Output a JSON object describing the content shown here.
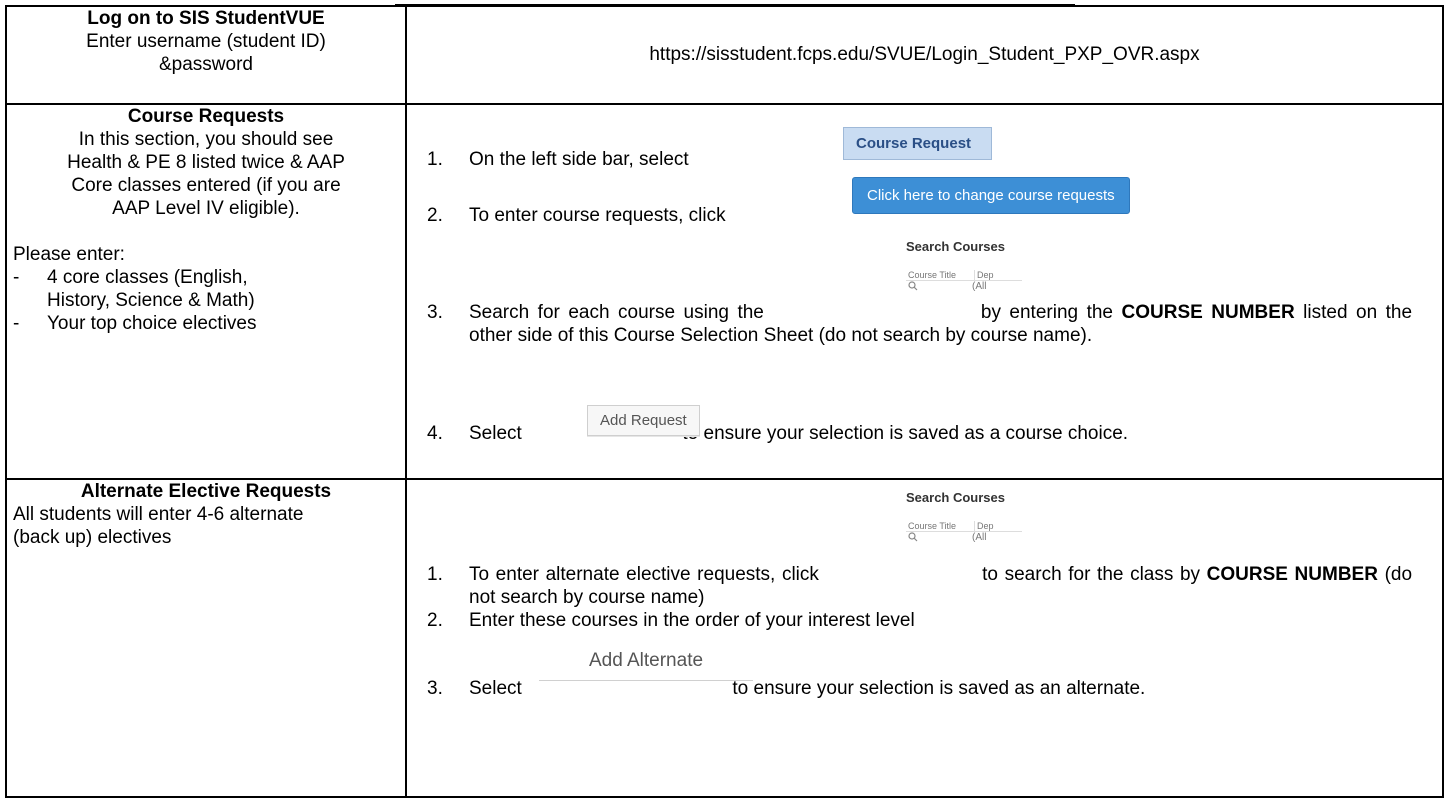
{
  "section_1": {
    "title": "Log on to SIS StudentVUE",
    "desc_line1": "Enter username (student ID)",
    "desc_line2": "&password",
    "url": "https://sisstudent.fcps.edu/SVUE/Login_Student_PXP_OVR.aspx"
  },
  "section_2": {
    "title": "Course Requests",
    "desc": [
      "In this section, you should see",
      "Health & PE 8 listed twice & AAP",
      "Core classes entered (if you are",
      "AAP Level IV eligible)."
    ],
    "please_enter": "Please enter:",
    "bullets": [
      {
        "dash": "-",
        "line1": "4 core classes (English,",
        "line2": "History, Science & Math)"
      },
      {
        "dash": "-",
        "line1": "Your top choice electives",
        "line2": ""
      }
    ],
    "steps": [
      {
        "num": "1.",
        "text": "On the left side bar, select"
      },
      {
        "num": "2.",
        "text": "To enter course requests, click"
      },
      {
        "num": "3.",
        "text_before": "Search for each course using the",
        "text_mid": "by entering the",
        "bold": "COURSE NUMBER",
        "text_after": "listed on the other side of this Course Selection Sheet (do not search by course name)."
      },
      {
        "num": "4.",
        "text_before": "Select",
        "text_after": "to ensure your selection is saved as a course choice."
      }
    ],
    "ui": {
      "course_request_btn": "Course Request",
      "change_btn": "Click here to change course requests",
      "search_header": "Search Courses",
      "search_col1": "Course Title",
      "search_col2": "Dep",
      "search_icon": "magnifier-icon",
      "search_val2": "(All",
      "add_request_btn": "Add Request"
    }
  },
  "section_3": {
    "title": "Alternate Elective Requests",
    "desc_line1": "All students will enter 4-6 alternate",
    "desc_line2": "(back up) electives",
    "steps": [
      {
        "num": "1.",
        "text_before": "To enter alternate elective requests, click",
        "text_after": "to search for the class by",
        "bold": "COURSE NUMBER",
        "text_tail": "(do not search by course name)"
      },
      {
        "num": "2.",
        "text": "Enter these courses in the order of your interest level"
      },
      {
        "num": "3.",
        "text_before": "Select",
        "text_after": "to ensure your selection is saved as an alternate."
      }
    ],
    "ui": {
      "search_header": "Search Courses",
      "search_col1": "Course Title",
      "search_col2": "Dep",
      "search_val2": "(All",
      "add_alternate_btn": "Add Alternate"
    }
  }
}
